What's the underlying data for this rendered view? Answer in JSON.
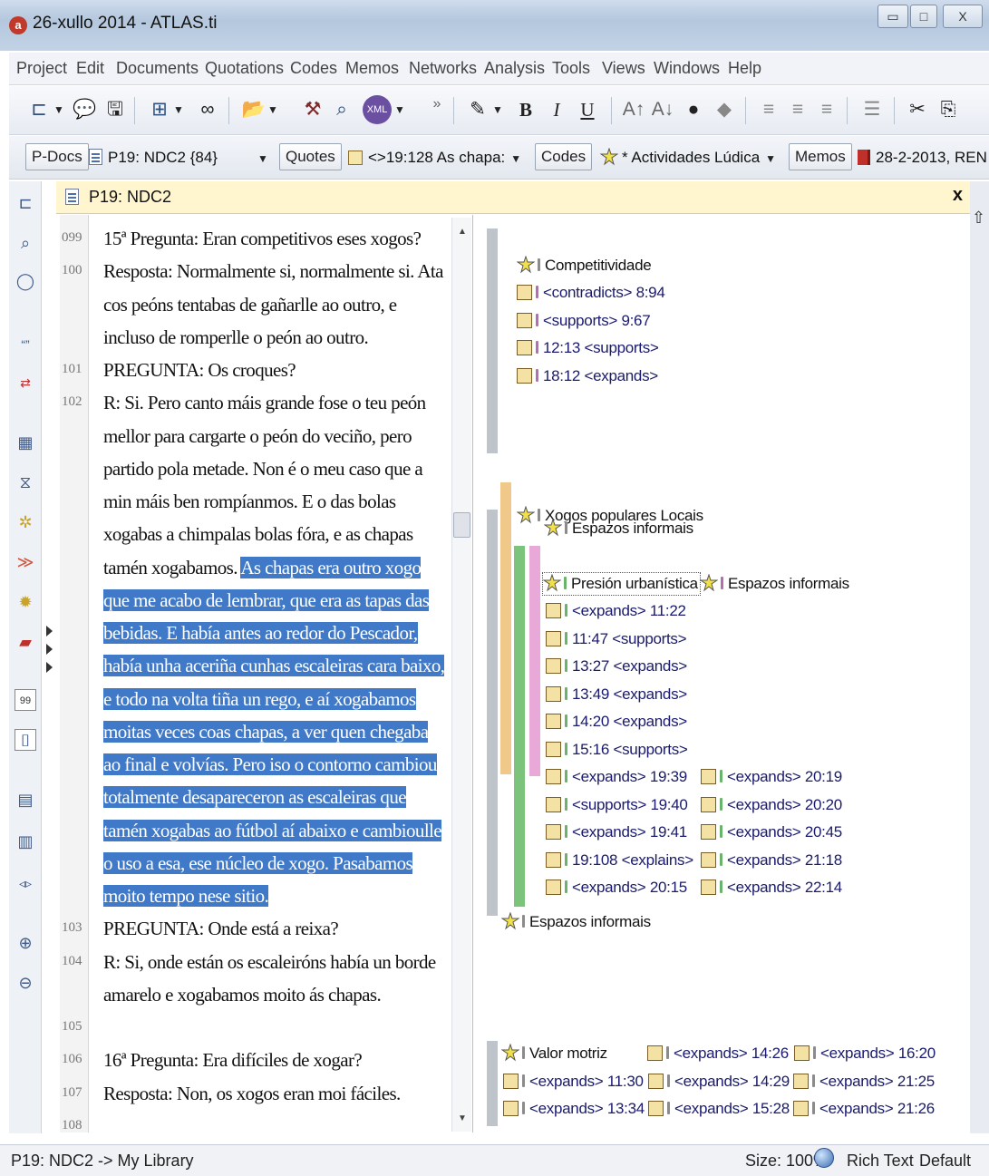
{
  "window": {
    "title": "26-xullo 2014 - ATLAS.ti",
    "min_label": "▭",
    "max_label": "□",
    "close_label": "X"
  },
  "menu": [
    "Project",
    "Edit",
    "Documents",
    "Quotations",
    "Codes",
    "Memos",
    "Networks",
    "Analysis",
    "Tools",
    "Views",
    "Windows",
    "Help"
  ],
  "toolbar": {
    "overflow": "»",
    "bold": "B",
    "italic": "I",
    "underline": "U",
    "xml": "XML"
  },
  "navbar": {
    "pdocs_button": "P-Docs",
    "pdoc_selected": "P19: NDC2 {84}",
    "quotes_button": "Quotes",
    "quote_selected": "<>19:128 As chapa:",
    "codes_button": "Codes",
    "code_selected": "* Actividades Lúdica",
    "memos_button": "Memos",
    "memo_selected": "28-2-2013, REN"
  },
  "document": {
    "title": "P19: NDC2",
    "close": "x",
    "lines": [
      {
        "num": "099",
        "text": "15ª Pregunta: Eran competitivos eses xogos?",
        "hl": ""
      },
      {
        "num": "100",
        "text": "Resposta: Normalmente si, normalmente si. Ata",
        "hl": ""
      },
      {
        "num": "",
        "text": "cos peóns tentabas de gañarlle ao outro, e",
        "hl": ""
      },
      {
        "num": "",
        "text": "incluso de romperlle o peón ao outro.",
        "hl": ""
      },
      {
        "num": "101",
        "text": "PREGUNTA: Os croques?",
        "hl": ""
      },
      {
        "num": "102",
        "text": "R: Si. Pero canto máis grande fose o teu peón",
        "hl": ""
      },
      {
        "num": "",
        "text": "mellor para cargarte o peón do veciño, pero",
        "hl": ""
      },
      {
        "num": "",
        "text": "partido pola metade. Non é o meu caso que a",
        "hl": ""
      },
      {
        "num": "",
        "text": "min máis ben rompíanmos. E o das bolas",
        "hl": ""
      },
      {
        "num": "",
        "text": "xogabas a chimpalas bolas fóra, e as chapas",
        "hl": ""
      },
      {
        "num": "",
        "text": "tamén xogabamos. ",
        "hl": "As chapas era outro xogo"
      },
      {
        "num": "",
        "text": "",
        "hl": "que me acabo de lembrar, que era as tapas das"
      },
      {
        "num": "",
        "text": "",
        "hl": "bebidas. E había antes ao redor do Pescador,"
      },
      {
        "num": "",
        "text": "",
        "hl": "había unha aceriña cunhas escaleiras cara baixo,"
      },
      {
        "num": "",
        "text": "",
        "hl": "e todo na volta tiña un rego, e aí xogabamos"
      },
      {
        "num": "",
        "text": "",
        "hl": "moitas veces coas chapas, a ver quen chegaba"
      },
      {
        "num": "",
        "text": "",
        "hl": "ao final e volvías. Pero iso o contorno cambiou"
      },
      {
        "num": "",
        "text": "",
        "hl": "totalmente desapareceron as escaleiras que"
      },
      {
        "num": "",
        "text": "",
        "hl": "tamén xogabas ao fútbol aí abaixo e cambioulle"
      },
      {
        "num": "",
        "text": "",
        "hl": "o uso a esa, ese núcleo de xogo. Pasabamos"
      },
      {
        "num": "",
        "text": "",
        "hl": "moito tempo nese sitio."
      },
      {
        "num": "103",
        "text": "PREGUNTA: Onde está a reixa?",
        "hl": ""
      },
      {
        "num": "104",
        "text": "R: Si,  onde están os escaleiróns había un borde",
        "hl": ""
      },
      {
        "num": "",
        "text": "amarelo e xogabamos moito ás chapas.",
        "hl": ""
      },
      {
        "num": "105",
        "text": "",
        "hl": ""
      },
      {
        "num": "106",
        "text": "16ª Pregunta: Era difíciles de xogar?",
        "hl": ""
      },
      {
        "num": "107",
        "text": "Resposta: Non, os xogos eran moi fáciles.",
        "hl": ""
      },
      {
        "num": "108",
        "text": "",
        "hl": ""
      }
    ]
  },
  "margin": {
    "colors": {
      "gray": "#bfc3ca",
      "orange": "#f0c98a",
      "green": "#7cc37c",
      "pink": "#e8a9d9"
    },
    "codes": {
      "competitividade": "Competitividade",
      "xogos_populares": "Xogos populares Locais",
      "espazos_informais_overlap": "Espazos informais",
      "presion": "Presión urbanística",
      "espazos_informais_side": "Espazos informais",
      "espazos_informais_lower": "Espazos informais",
      "valor_motriz": "Valor motriz"
    },
    "quotes_competitividade": [
      "<contradicts> 8:94",
      "<supports> 9:67",
      "12:13 <supports>",
      "18:12 <expands>"
    ],
    "quotes_presion_col1": [
      "<expands> 11:22",
      "11:47 <supports>",
      "13:27 <expands>",
      "13:49 <expands>",
      "14:20 <expands>",
      "15:16 <supports>",
      "<expands> 19:39",
      "<supports> 19:40",
      "<expands> 19:41",
      "19:108 <explains>",
      "<expands> 20:15"
    ],
    "quotes_presion_col2": [
      "<expands> 20:19",
      "<expands> 20:20",
      "<expands> 20:45",
      "<expands> 21:18",
      "<expands> 22:14"
    ],
    "quotes_valor_row1": [
      "<expands> 14:26",
      "<expands> 16:20"
    ],
    "quotes_valor_row2": [
      "<expands> 11:30",
      "<expands> 14:29",
      "<expands> 21:25"
    ],
    "quotes_valor_row3": [
      "<expands> 13:34",
      "<expands> 15:28",
      "<expands> 21:26"
    ]
  },
  "status": {
    "path": "P19: NDC2 -> My Library",
    "size": "Size: 100%",
    "format": "Rich Text",
    "style": "Default"
  }
}
